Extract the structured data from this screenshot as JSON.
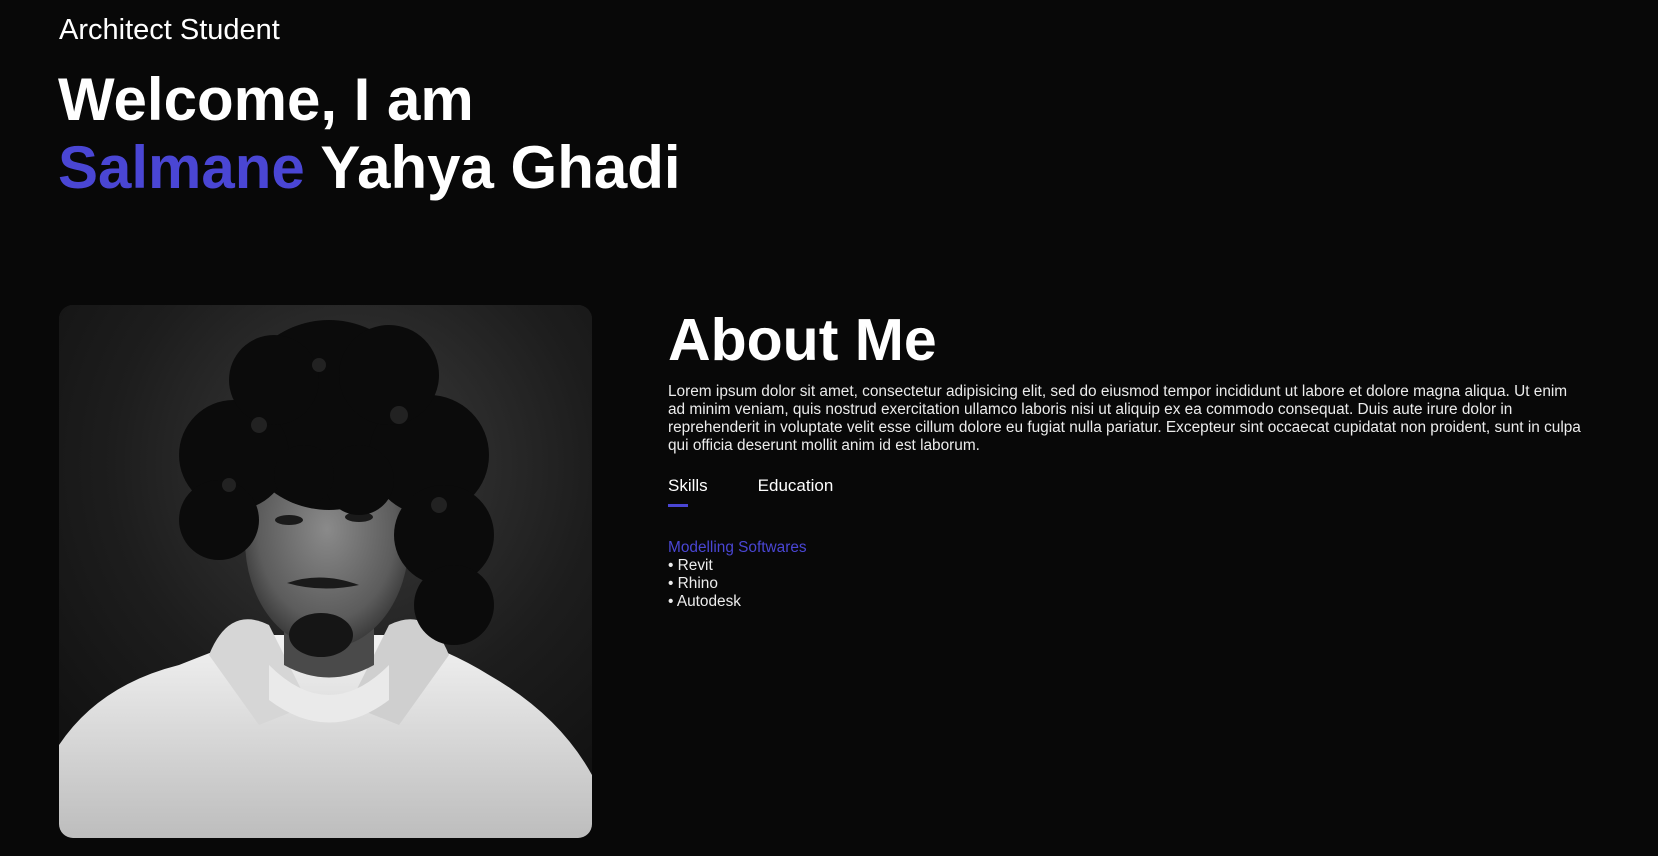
{
  "header": {
    "subtitle": "Architect Student",
    "welcome_line": "Welcome, I am",
    "first_name": "Salmane",
    "last_name": "Yahya Ghadi"
  },
  "photo": {
    "alt": "Portrait"
  },
  "about": {
    "title": "About Me",
    "text": "Lorem ipsum dolor sit amet, consectetur adipisicing elit, sed do eiusmod tempor incididunt ut labore et dolore magna aliqua. Ut enim ad minim veniam, quis nostrud exercitation ullamco laboris nisi ut aliquip ex ea commodo consequat. Duis aute irure dolor in reprehenderit in voluptate velit esse cillum dolore eu fugiat nulla pariatur. Excepteur sint occaecat cupidatat non proident, sunt in culpa qui officia deserunt mollit anim id est laborum.",
    "tabs": [
      {
        "label": "Skills",
        "active": true
      },
      {
        "label": "Education",
        "active": false
      }
    ],
    "skills": {
      "category": "Modelling Softwares",
      "items": [
        "• Revit",
        "• Rhino",
        "• Autodesk"
      ]
    }
  },
  "colors": {
    "background": "#080808",
    "accent": "#4a46d4",
    "text": "#ffffff"
  }
}
